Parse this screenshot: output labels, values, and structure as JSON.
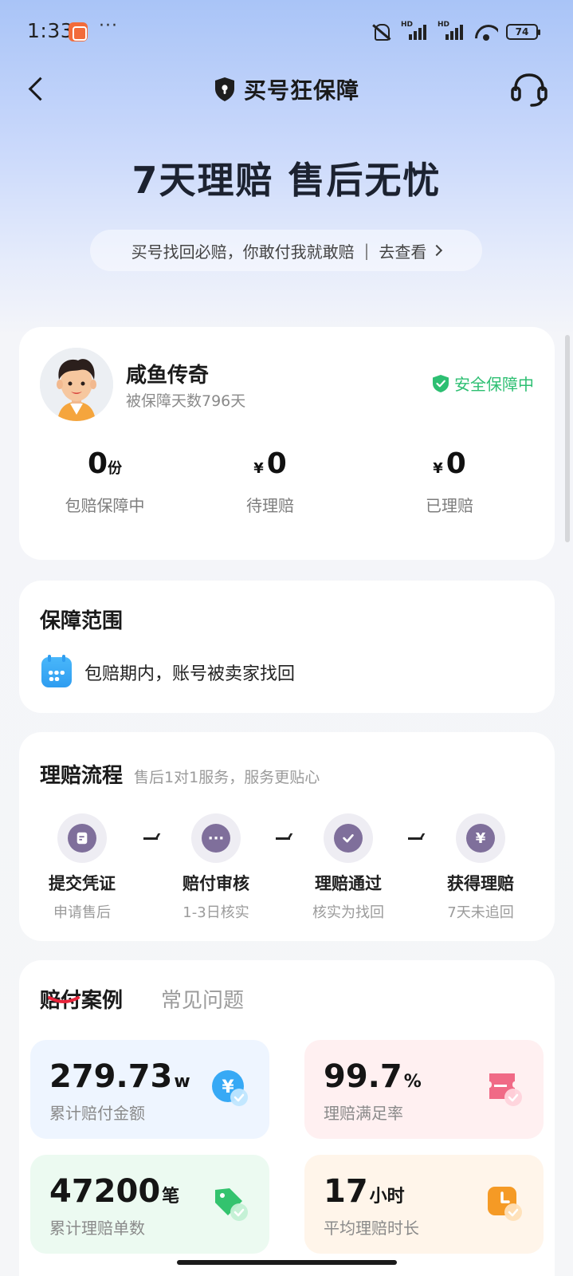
{
  "status_bar": {
    "time": "1:33",
    "dots": "···",
    "battery": "74",
    "hd1": "HD",
    "hd2": "HD"
  },
  "nav": {
    "title": "买号狂保障"
  },
  "hero": {
    "title": "7天理赔 售后无忧",
    "pill_text": "买号找回必赔，你敢付我就敢赔",
    "pill_sep": "|",
    "pill_link": "去查看"
  },
  "user": {
    "name": "咸鱼传奇",
    "days": "被保障天数796天",
    "status": "安全保障中",
    "stats": [
      {
        "value": "0",
        "unit": "份",
        "prefix": "",
        "label": "包赔保障中"
      },
      {
        "value": "0",
        "unit": "",
        "prefix": "¥",
        "label": "待理赔"
      },
      {
        "value": "0",
        "unit": "",
        "prefix": "¥",
        "label": "已理赔"
      }
    ]
  },
  "scope": {
    "title": "保障范围",
    "item": "包赔期内，账号被卖家找回"
  },
  "process": {
    "title": "理赔流程",
    "subtitle": "售后1对1服务，服务更贴心",
    "steps": [
      {
        "title": "提交凭证",
        "desc": "申请售后",
        "icon": "document-icon"
      },
      {
        "title": "赔付审核",
        "desc": "1-3日核实",
        "icon": "more-dots-icon",
        "glyph": "···"
      },
      {
        "title": "理赔通过",
        "desc": "核实为找回",
        "icon": "check-icon"
      },
      {
        "title": "获得理赔",
        "desc": "7天未追回",
        "icon": "yen-icon",
        "glyph": "¥"
      }
    ]
  },
  "cases": {
    "tabs": [
      "赔付案例",
      "常见问题"
    ],
    "active_tab": 0,
    "tiles": [
      {
        "value": "279.73",
        "unit": "w",
        "label": "累计赔付金额",
        "bg": "#eef5ff",
        "icon": "yen-check-icon",
        "icon_color": "#37a9f5"
      },
      {
        "value": "99.7",
        "unit": "%",
        "label": "理赔满足率",
        "bg": "#fff0f1",
        "icon": "ticket-check-icon",
        "icon_color": "#f06a86"
      },
      {
        "value": "47200",
        "unit": "笔",
        "label": "累计理赔单数",
        "bg": "#ecfaf1",
        "icon": "tag-check-icon",
        "icon_color": "#33c36e"
      },
      {
        "value": "17",
        "unit": "小时",
        "label": "平均理赔时长",
        "bg": "#fff5ea",
        "icon": "clock-check-icon",
        "icon_color": "#f59a25"
      }
    ]
  },
  "colors": {
    "accent_green": "#2dbf72",
    "tab_underline": "#e8253b",
    "step_purple": "#7f6f9b"
  }
}
